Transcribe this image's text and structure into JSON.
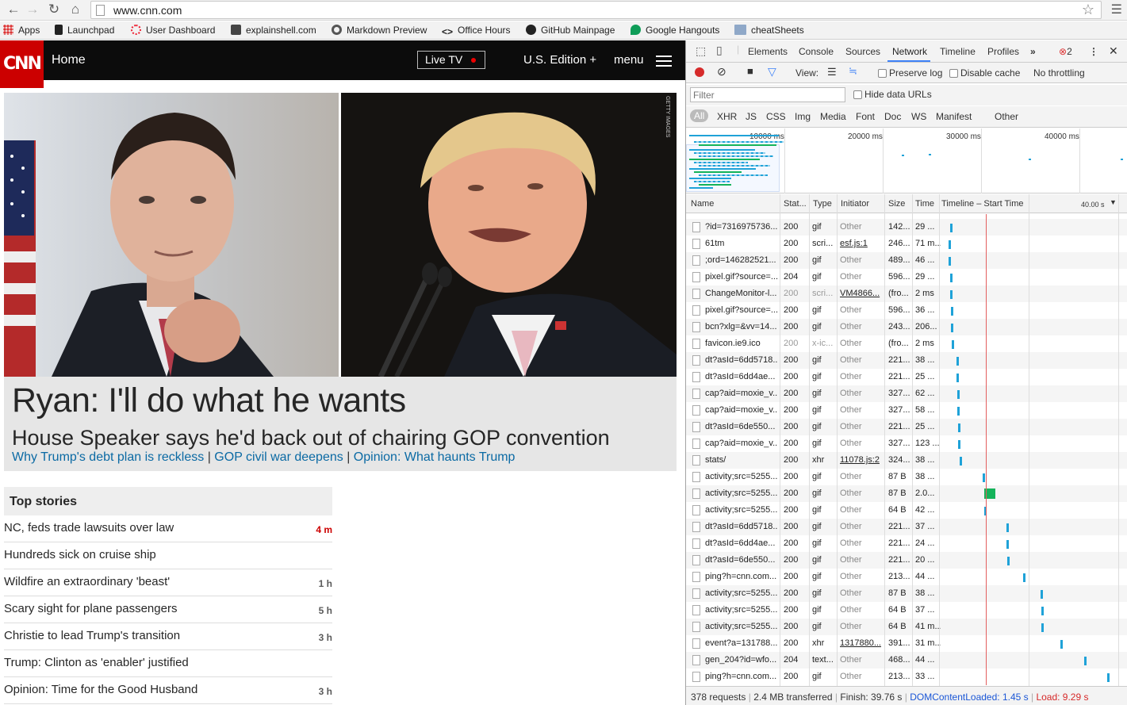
{
  "browser": {
    "url": "www.cnn.com",
    "bookmarks": [
      "Apps",
      "Launchpad",
      "User Dashboard",
      "explainshell.com",
      "Markdown Preview",
      "Office Hours",
      "GitHub Mainpage",
      "Google Hangouts",
      "cheatSheets"
    ]
  },
  "cnn": {
    "logo": "CNN",
    "home": "Home",
    "live_tv": "Live TV",
    "edition": "U.S. Edition +",
    "menu": "menu",
    "photo_credit": "GETTY IMAGES",
    "headline": "Ryan: I'll do what he wants",
    "subhead": "House Speaker says he'd back out of chairing GOP convention",
    "related": [
      "Why Trump's debt plan is reckless",
      "GOP civil war deepens",
      "Opinion: What haunts Trump"
    ],
    "top_stories_title": "Top stories",
    "top_stories": [
      {
        "title": "NC, feds trade lawsuits over law",
        "ago": "4 m",
        "new": true
      },
      {
        "title": "Hundreds sick on cruise ship",
        "ago": ""
      },
      {
        "title": "Wildfire an extraordinary 'beast'",
        "ago": "1 h"
      },
      {
        "title": "Scary sight for plane passengers",
        "ago": "5 h"
      },
      {
        "title": "Christie to lead Trump's transition",
        "ago": "3 h"
      },
      {
        "title": "Trump: Clinton as 'enabler' justified",
        "ago": ""
      },
      {
        "title": "Opinion: Time for the Good Husband",
        "ago": "3 h"
      }
    ]
  },
  "devtools": {
    "tabs": [
      "Elements",
      "Console",
      "Sources",
      "Network",
      "Timeline",
      "Profiles"
    ],
    "active_tab": "Network",
    "error_count": "2",
    "toolbar": {
      "view": "View:",
      "preserve_log": "Preserve log",
      "disable_cache": "Disable cache",
      "throttling": "No throttling"
    },
    "filter_placeholder": "Filter",
    "hide_data_urls": "Hide data URLs",
    "types": [
      "All",
      "XHR",
      "JS",
      "CSS",
      "Img",
      "Media",
      "Font",
      "Doc",
      "WS",
      "Manifest",
      "Other"
    ],
    "overview_ticks": [
      "10000 ms",
      "20000 ms",
      "30000 ms",
      "40000 ms"
    ],
    "columns": [
      "Name",
      "Stat...",
      "Type",
      "Initiator",
      "Size",
      "Time",
      "Timeline – Start Time",
      "40.00 s"
    ],
    "requests": [
      {
        "name": "?id=7316975736...",
        "status": "200",
        "type": "gif",
        "initiator": "Other",
        "size": "142...",
        "time": "29 ...",
        "start": 0.278,
        "dur": 0.006
      },
      {
        "name": "61tm",
        "status": "200",
        "type": "scri...",
        "initiator": "esf.js:1",
        "initiator_link": true,
        "size": "246...",
        "time": "71 m...",
        "start": 0.277,
        "dur": 0.006
      },
      {
        "name": ";ord=146282521...",
        "status": "200",
        "type": "gif",
        "initiator": "Other",
        "size": "489...",
        "time": "46 ...",
        "start": 0.277,
        "dur": 0.005
      },
      {
        "name": "pixel.gif?source=...",
        "status": "204",
        "type": "gif",
        "initiator": "Other",
        "size": "596...",
        "time": "29 ...",
        "start": 0.278,
        "dur": 0.005
      },
      {
        "name": "ChangeMonitor-l...",
        "status": "200",
        "type": "scri...",
        "initiator": "VM4866...",
        "initiator_link": true,
        "size": "(fro...",
        "time": "2 ms",
        "dim": true,
        "start": 0.278,
        "dur": 0.003
      },
      {
        "name": "pixel.gif?source=...",
        "status": "200",
        "type": "gif",
        "initiator": "Other",
        "size": "596...",
        "time": "36 ...",
        "start": 0.279,
        "dur": 0.005
      },
      {
        "name": "bcn?xlg=&vv=14...",
        "status": "200",
        "type": "gif",
        "initiator": "Other",
        "size": "243...",
        "time": "206...",
        "start": 0.279,
        "dur": 0.006
      },
      {
        "name": "favicon.ie9.ico",
        "status": "200",
        "type": "x-ic...",
        "initiator": "Other",
        "size": "(fro...",
        "time": "2 ms",
        "dim": true,
        "start": 0.28,
        "dur": 0.003
      },
      {
        "name": "dt?asId=6dd5718...",
        "status": "200",
        "type": "gif",
        "initiator": "Other",
        "size": "221...",
        "time": "38 ...",
        "start": 0.284,
        "dur": 0.006
      },
      {
        "name": "dt?asId=6dd4ae...",
        "status": "200",
        "type": "gif",
        "initiator": "Other",
        "size": "221...",
        "time": "25 ...",
        "start": 0.284,
        "dur": 0.006
      },
      {
        "name": "cap?aid=moxie_v...",
        "status": "200",
        "type": "gif",
        "initiator": "Other",
        "size": "327...",
        "time": "62 ...",
        "start": 0.285,
        "dur": 0.006
      },
      {
        "name": "cap?aid=moxie_v...",
        "status": "200",
        "type": "gif",
        "initiator": "Other",
        "size": "327...",
        "time": "58 ...",
        "start": 0.285,
        "dur": 0.006
      },
      {
        "name": "dt?asId=6de550...",
        "status": "200",
        "type": "gif",
        "initiator": "Other",
        "size": "221...",
        "time": "25 ...",
        "start": 0.286,
        "dur": 0.006
      },
      {
        "name": "cap?aid=moxie_v...",
        "status": "200",
        "type": "gif",
        "initiator": "Other",
        "size": "327...",
        "time": "123 ...",
        "start": 0.286,
        "dur": 0.006
      },
      {
        "name": "stats/",
        "status": "200",
        "type": "xhr",
        "initiator": "11078.js:2",
        "initiator_link": true,
        "size": "324...",
        "time": "38 ...",
        "start": 0.287,
        "dur": 0.006
      },
      {
        "name": "activity;src=5255...",
        "status": "200",
        "type": "gif",
        "initiator": "Other",
        "size": "87 B",
        "time": "38 ...",
        "start": 0.309,
        "dur": 0.006
      },
      {
        "name": "activity;src=5255...",
        "status": "200",
        "type": "gif",
        "initiator": "Other",
        "size": "87 B",
        "time": "2.0...",
        "start": 0.31,
        "dur": 0.028,
        "green": true
      },
      {
        "name": "activity;src=5255...",
        "status": "200",
        "type": "gif",
        "initiator": "Other",
        "size": "64 B",
        "time": "42 ...",
        "start": 0.31,
        "dur": 0.006
      },
      {
        "name": "dt?asId=6dd5718...",
        "status": "200",
        "type": "gif",
        "initiator": "Other",
        "size": "221...",
        "time": "37 ...",
        "start": 0.331,
        "dur": 0.006
      },
      {
        "name": "dt?asId=6dd4ae...",
        "status": "200",
        "type": "gif",
        "initiator": "Other",
        "size": "221...",
        "time": "24 ...",
        "start": 0.331,
        "dur": 0.006
      },
      {
        "name": "dt?asId=6de550...",
        "status": "200",
        "type": "gif",
        "initiator": "Other",
        "size": "221...",
        "time": "20 ...",
        "start": 0.332,
        "dur": 0.006
      },
      {
        "name": "ping?h=cnn.com...",
        "status": "200",
        "type": "gif",
        "initiator": "Other",
        "size": "213...",
        "time": "44 ...",
        "start": 0.347,
        "dur": 0.006
      },
      {
        "name": "activity;src=5255...",
        "status": "200",
        "type": "gif",
        "initiator": "Other",
        "size": "87 B",
        "time": "38 ...",
        "start": 0.363,
        "dur": 0.006
      },
      {
        "name": "activity;src=5255...",
        "status": "200",
        "type": "gif",
        "initiator": "Other",
        "size": "64 B",
        "time": "37 ...",
        "start": 0.364,
        "dur": 0.006
      },
      {
        "name": "activity;src=5255...",
        "status": "200",
        "type": "gif",
        "initiator": "Other",
        "size": "64 B",
        "time": "41 m...",
        "start": 0.364,
        "dur": 0.006
      },
      {
        "name": "event?a=131788...",
        "status": "200",
        "type": "xhr",
        "initiator": "1317880...",
        "initiator_link": true,
        "size": "391...",
        "time": "31 m...",
        "start": 0.382,
        "dur": 0.006
      },
      {
        "name": "gen_204?id=wfo...",
        "status": "204",
        "type": "text...",
        "initiator": "Other",
        "size": "468...",
        "time": "44 ...",
        "start": 0.404,
        "dur": 0.006
      },
      {
        "name": "ping?h=cnn.com...",
        "status": "200",
        "type": "gif",
        "initiator": "Other",
        "size": "213...",
        "time": "33 ...",
        "start": 0.426,
        "dur": 0.006
      }
    ],
    "status_bar": {
      "requests": "378 requests",
      "transferred": "2.4 MB transferred",
      "finish": "Finish: 39.76 s",
      "dcl": "DOMContentLoaded: 1.45 s",
      "load": "Load: 9.29 s"
    }
  }
}
